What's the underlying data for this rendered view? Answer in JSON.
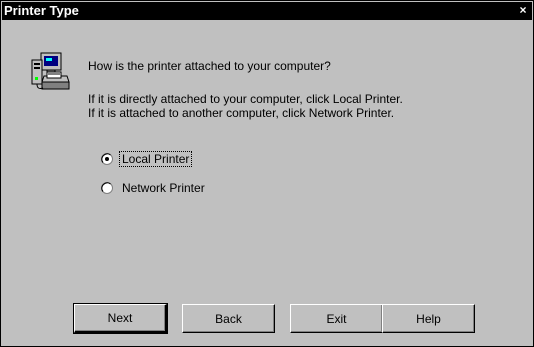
{
  "window": {
    "title": "Printer Type",
    "close_glyph": "×"
  },
  "icon": {
    "name": "printer-computer-icon"
  },
  "prompt": {
    "question": "How is the printer attached to your computer?",
    "info_line1": "If it is directly attached to your computer, click Local Printer.",
    "info_line2": "If it is attached to another computer, click Network Printer."
  },
  "options": [
    {
      "label": "Local Printer",
      "selected": true
    },
    {
      "label": "Network Printer",
      "selected": false
    }
  ],
  "buttons": {
    "next": "Next",
    "back": "Back",
    "exit": "Exit",
    "help": "Help"
  }
}
